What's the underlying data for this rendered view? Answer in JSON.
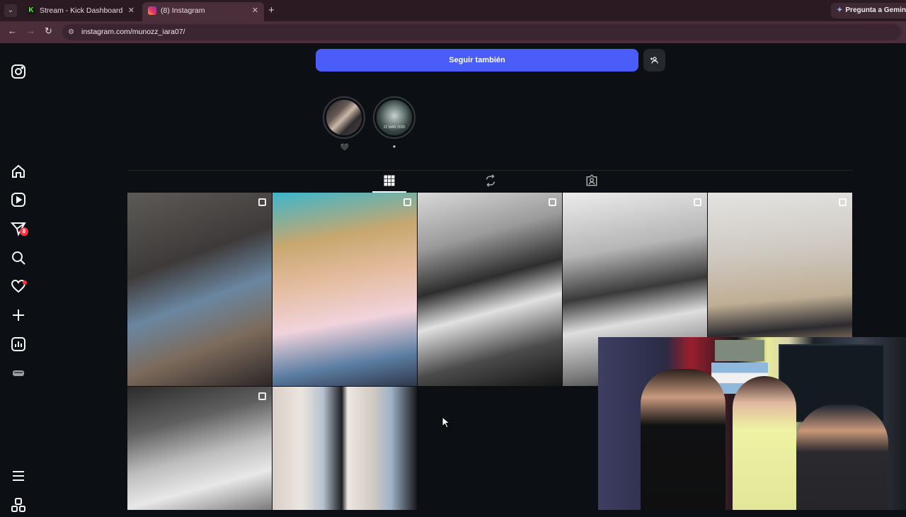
{
  "browser": {
    "tabs": [
      {
        "title": "Stream - Kick Dashboard",
        "favicon": "kick-icon"
      },
      {
        "title": "(8) Instagram",
        "favicon": "instagram-icon"
      }
    ],
    "new_tab_label": "+",
    "gemini_label": "Pregunta a Gemini",
    "url": "instagram.com/munozz_iara07/"
  },
  "instagram": {
    "follow_button_label": "Seguir también",
    "notifications_badge": "8",
    "highlights": [
      {
        "label": "🖤",
        "cover_text": ""
      },
      {
        "label": "•",
        "cover_text": "22 MAR 2025"
      }
    ],
    "profile_tabs": [
      "posts-grid",
      "reposts",
      "tagged"
    ],
    "posts_count_visible": 7
  },
  "colors": {
    "follow_button": "#4a5df9",
    "background": "#0c1014",
    "tabbar": "#2c1a22",
    "addressbar": "#4a2f3a",
    "badge": "#ff3040"
  }
}
